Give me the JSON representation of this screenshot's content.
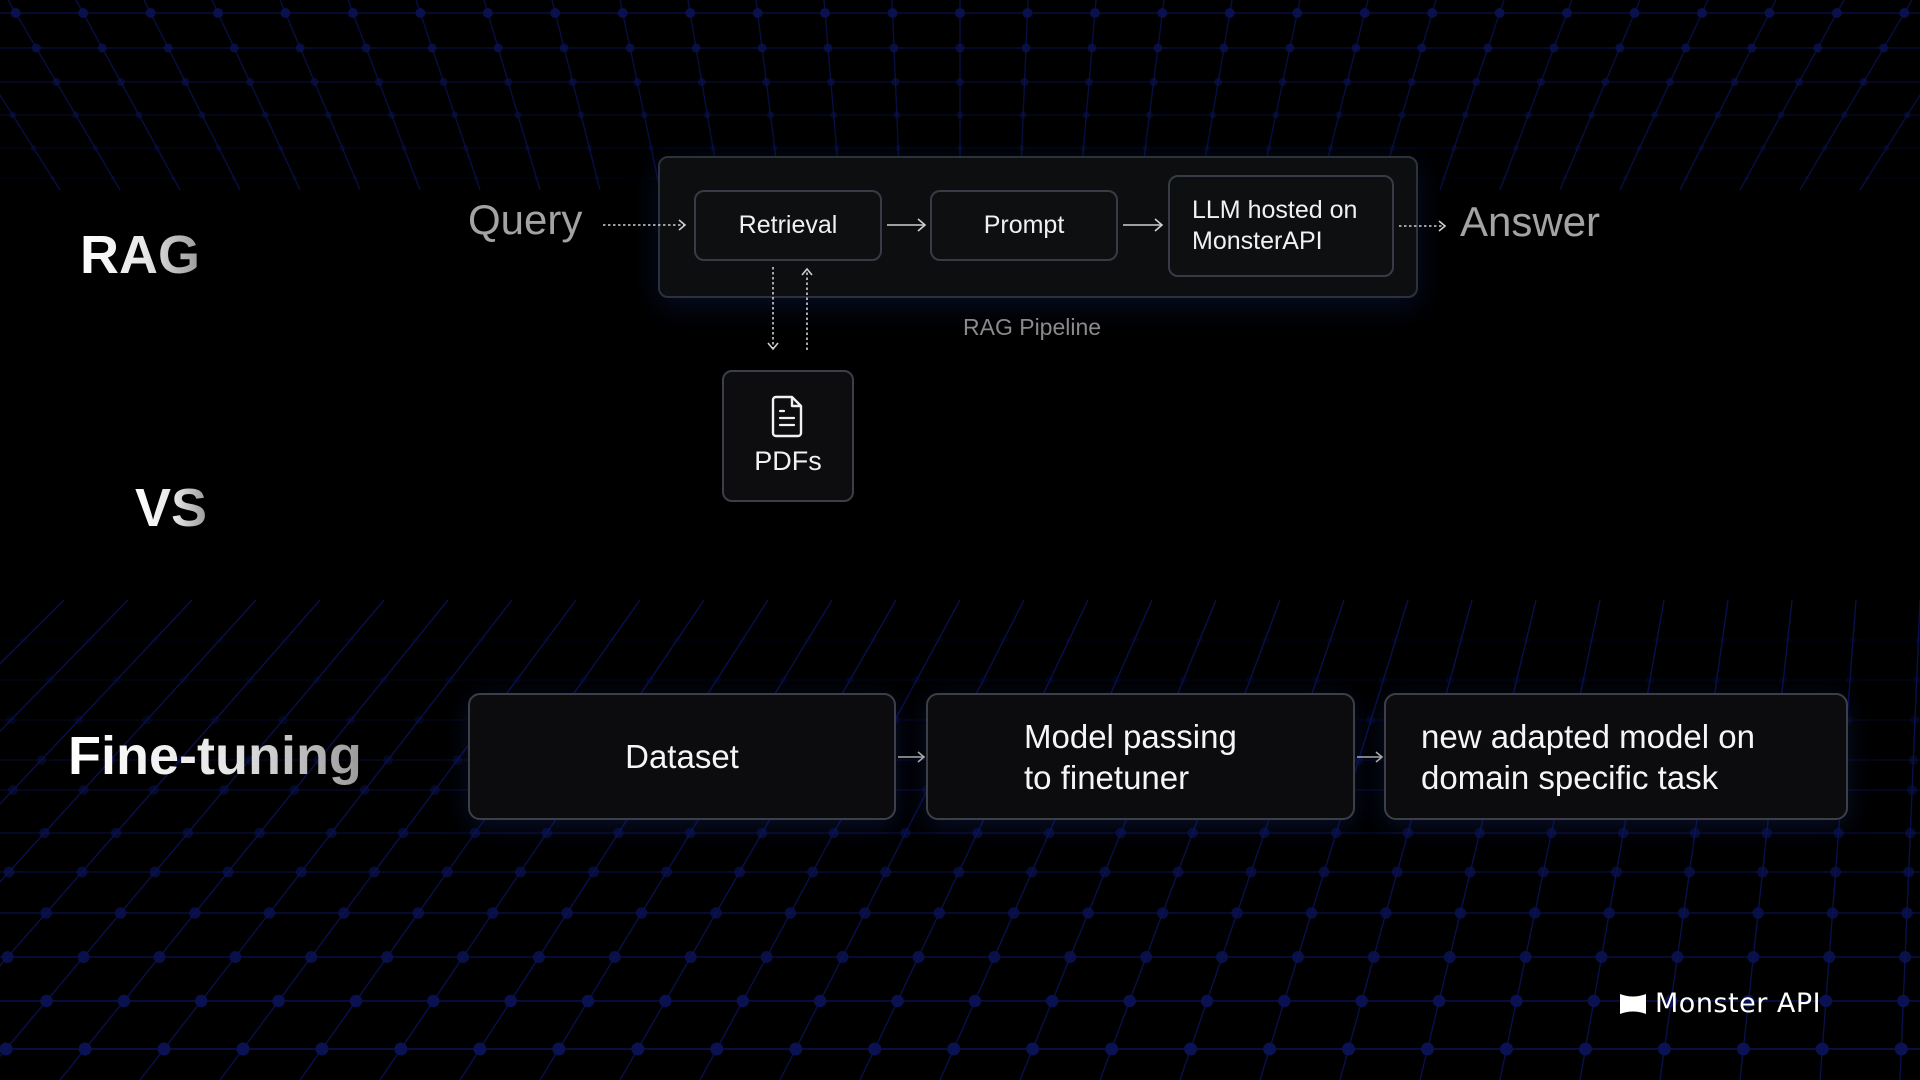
{
  "slide": {
    "rag_title": "RAG",
    "vs_title": "VS",
    "finetune_title": "Fine-tuning"
  },
  "rag": {
    "input_label": "Query",
    "output_label": "Answer",
    "pipeline_caption": "RAG Pipeline",
    "nodes": [
      {
        "label": "Retrieval"
      },
      {
        "label": "Prompt"
      },
      {
        "label_line1": "LLM hosted on",
        "label_line2": "MonsterAPI"
      }
    ],
    "source": {
      "label": "PDFs",
      "icon": "document-icon"
    }
  },
  "finetuning": {
    "nodes": [
      {
        "label": "Dataset"
      },
      {
        "label_line1": "Model passing",
        "label_line2": "to finetuner"
      },
      {
        "label_line1": "new adapted model on",
        "label_line2": "domain specific task"
      }
    ]
  },
  "brand": {
    "name": "Monster API",
    "icon": "monster-api-logo-icon"
  },
  "colors": {
    "background": "#000000",
    "grid": "#0a1253",
    "node_border": "#363b44",
    "muted_text": "#a3a3a3"
  }
}
